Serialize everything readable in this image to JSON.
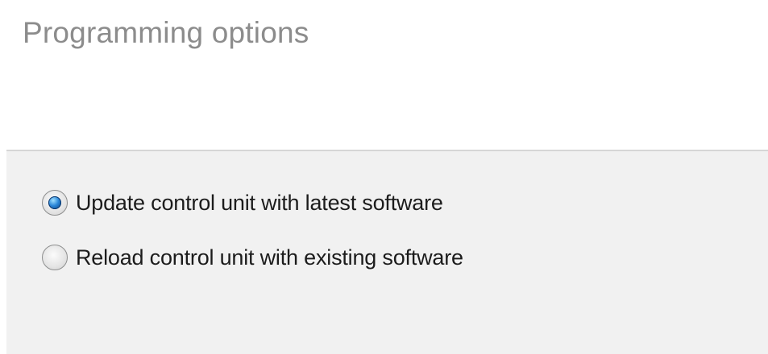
{
  "page": {
    "title": "Programming options"
  },
  "options": [
    {
      "label": "Update control unit with latest software",
      "selected": true
    },
    {
      "label": "Reload control unit with existing software",
      "selected": false
    }
  ],
  "colors": {
    "title": "#8c8c8c",
    "panel_background": "#f1f1f1",
    "divider": "#d6d6d6",
    "radio_selected": "#2a86d8"
  },
  "icons": {
    "selected": "radio-selected-icon",
    "unselected": "radio-unselected-icon"
  }
}
